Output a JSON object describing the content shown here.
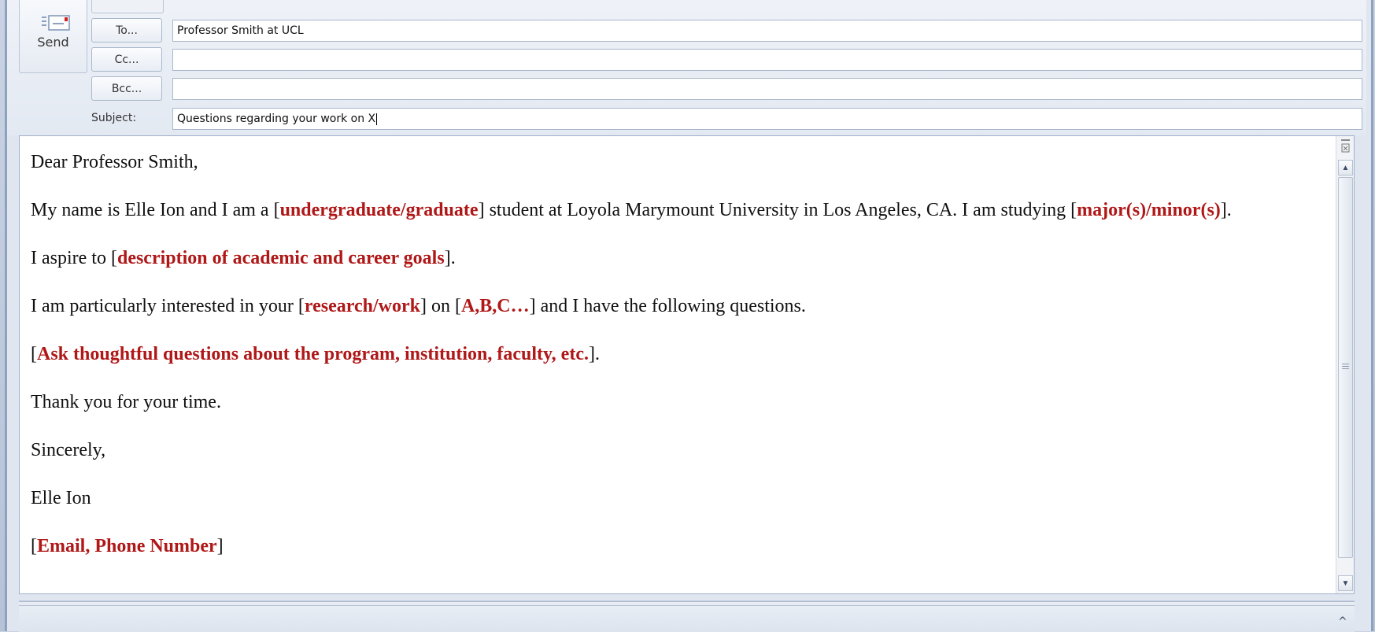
{
  "toolbar": {
    "send_label": "Send"
  },
  "header": {
    "to_label": "To...",
    "cc_label": "Cc...",
    "bcc_label": "Bcc...",
    "subject_label": "Subject:",
    "to_value": "Professor Smith at UCL",
    "cc_value": "",
    "bcc_value": "",
    "subject_value": "Questions regarding your work on X"
  },
  "body": {
    "greeting": "Dear Professor Smith,",
    "p1": {
      "t1": "My name is  Elle Ion and I am a [",
      "ph1": "undergraduate/graduate",
      "t2": "] student at Loyola Marymount University in Los Angeles, CA. I am studying [",
      "ph2": "major(s)/minor(s)",
      "t3": "]."
    },
    "p2": {
      "t1": "I aspire to [",
      "ph1": "description of academic and career goals",
      "t2": "]."
    },
    "p3": {
      "t1": "I am particularly interested in your [",
      "ph1": "research/work",
      "t2": "] on [",
      "ph2": "A,B,C…",
      "t3": "] and I have the following questions."
    },
    "p4": {
      "t1": "[",
      "ph1": "Ask thoughtful questions about the program, institution, faculty, etc.",
      "t2": "]."
    },
    "thanks": "Thank you for your time.",
    "closing": "Sincerely,",
    "signature": "Elle Ion",
    "p5": {
      "t1": "[",
      "ph1": "Email, Phone Number",
      "t2": "]"
    }
  },
  "icons": {
    "send": "send-envelope-icon",
    "scroll_top": "format-icon",
    "scroll_up": "arrow-up-icon",
    "scroll_down": "arrow-down-icon",
    "expand": "chevron-up-icon"
  },
  "colors": {
    "placeholder_text": "#b01818",
    "frame": "#8ea1bd"
  }
}
